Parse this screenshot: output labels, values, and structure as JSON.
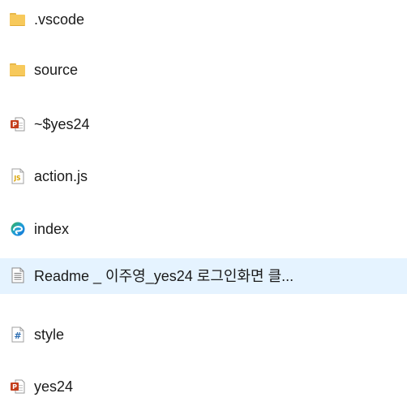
{
  "files": [
    {
      "name": ".vscode",
      "icon": "folder-icon",
      "kind": "folder"
    },
    {
      "name": "source",
      "icon": "folder-icon",
      "kind": "folder"
    },
    {
      "name": "~$yes24",
      "icon": "powerpoint-file-icon",
      "kind": "pptx"
    },
    {
      "name": "action.js",
      "icon": "javascript-file-icon",
      "kind": "js"
    },
    {
      "name": "index",
      "icon": "edge-browser-icon",
      "kind": "html"
    },
    {
      "name": "Readme _ 이주영_yes24 로그인화면 클...",
      "icon": "text-document-icon",
      "kind": "txt",
      "selected": true
    },
    {
      "name": "style",
      "icon": "css-file-icon",
      "kind": "css"
    },
    {
      "name": "yes24",
      "icon": "powerpoint-file-icon",
      "kind": "pptx"
    }
  ],
  "colors": {
    "selection": "#e5f3ff",
    "folder": "#f7c95b",
    "powerpoint": "#c43e1c",
    "javascript_text": "#d9a200",
    "edge_blue": "#1570d8",
    "edge_green": "#37b34a"
  }
}
